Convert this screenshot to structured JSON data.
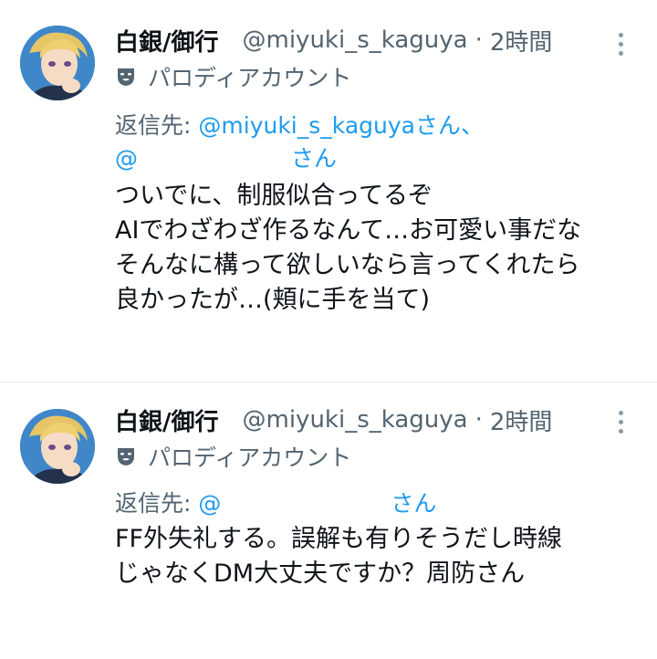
{
  "tweets": [
    {
      "display_name": "白銀/御行",
      "handle": "@miyuki_s_kaguya",
      "separator": "·",
      "time": "2時間",
      "parody_label": "パロディアカウント",
      "reply_prefix": "返信先:",
      "reply_mention_1": "@miyuki_s_kaguyaさん、",
      "reply_mention_2_at": "@",
      "reply_mention_2_suffix": "さん",
      "body_lines": [
        "ついでに、制服似合ってるぞ",
        "AIでわざわざ作るなんて…お可愛い事だな",
        "そんなに構って欲しいなら言ってくれたら",
        "良かったが…(頬に手を当て)"
      ]
    },
    {
      "display_name": "白銀/御行",
      "handle": "@miyuki_s_kaguya",
      "separator": "·",
      "time": "2時間",
      "parody_label": "パロディアカウント",
      "reply_prefix": "返信先:",
      "reply_mention_at": "@",
      "reply_mention_suffix": "さん",
      "body_lines": [
        "FF外失礼する。誤解も有りそうだし時線",
        "じゃなくDM大丈夫ですか？周防さん"
      ]
    }
  ],
  "icons": {
    "avatar": "avatar-image",
    "parody": "theater-mask-icon",
    "more": "more-options-icon"
  },
  "colors": {
    "text_primary": "#0f1419",
    "text_secondary": "#536471",
    "link": "#1d9bf0"
  }
}
